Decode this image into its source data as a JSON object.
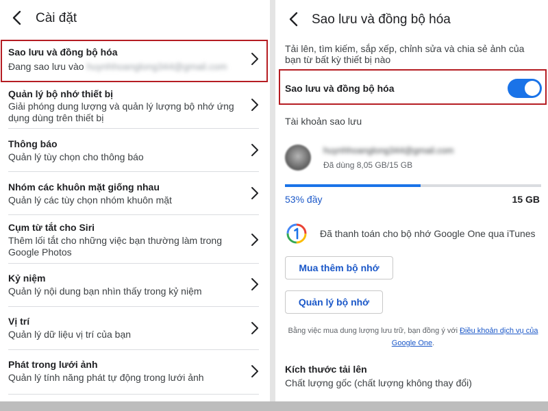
{
  "left": {
    "header": {
      "title": "Cài đặt"
    },
    "items": [
      {
        "title": "Sao lưu và đồng bộ hóa",
        "subtitle": "Đang sao lưu vào",
        "email": "huynhhoanglong344@gmail.com"
      },
      {
        "title": "Quản lý bộ nhớ thiết bị",
        "subtitle": "Giải phóng dung lượng và quản lý lượng bộ nhớ ứng dụng dùng trên thiết bị"
      },
      {
        "title": "Thông báo",
        "subtitle": "Quản lý tùy chọn cho thông báo"
      },
      {
        "title": "Nhóm các khuôn mặt giống nhau",
        "subtitle": "Quản lý các tùy chọn nhóm khuôn mặt"
      },
      {
        "title": "Cụm từ tắt cho Siri",
        "subtitle": "Thêm lối tắt cho những việc bạn thường làm trong Google Photos"
      },
      {
        "title": "Kỷ niệm",
        "subtitle": "Quản lý nội dung bạn nhìn thấy trong kỷ niệm"
      },
      {
        "title": "Vị trí",
        "subtitle": "Quản lý dữ liệu vị trí của bạn"
      },
      {
        "title": "Phát trong lưới ảnh",
        "subtitle": "Quản lý tính năng phát tự động trong lưới ảnh"
      }
    ]
  },
  "right": {
    "header": {
      "title": "Sao lưu và đồng bộ hóa"
    },
    "description": "Tải lên, tìm kiếm, sắp xếp, chỉnh sửa và chia sẻ ảnh của bạn từ bất kỳ thiết bị nào",
    "toggle": {
      "label": "Sao lưu và đồng bộ hóa",
      "on": true
    },
    "account_section": "Tài khoản sao lưu",
    "account": {
      "email": "huynhhoanglong344@gmail.com",
      "usage": "Đã dùng 8,05 GB/15 GB"
    },
    "storage": {
      "percent_label": "53% đầy",
      "total": "15 GB",
      "fraction": 0.53
    },
    "google_one": "Đã thanh toán cho bộ nhớ Google One qua iTunes",
    "buy_button": "Mua thêm bộ nhớ",
    "manage_button": "Quản lý bộ nhớ",
    "legal_text": "Bằng việc mua dung lượng lưu trữ, bạn đồng ý với",
    "legal_link": "Điều khoản dịch vụ của Google One",
    "legal_end": ".",
    "upload_size": {
      "title": "Kích thước tải lên",
      "value": "Chất lượng gốc (chất lượng không thay đổi)"
    }
  },
  "colors": {
    "accent": "#1a73e8",
    "highlight_border": "#b51c22",
    "link": "#1a57c8"
  },
  "icons": [
    "back-arrow-icon",
    "chevron-right-icon",
    "google-one-icon",
    "avatar"
  ]
}
